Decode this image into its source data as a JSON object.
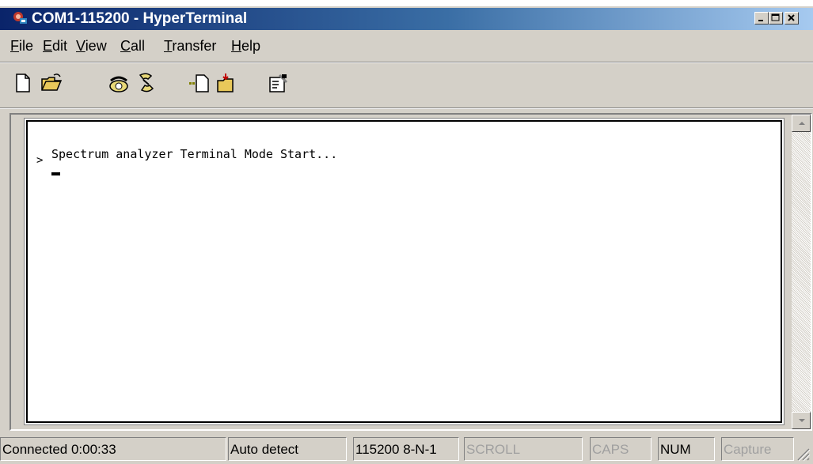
{
  "window": {
    "title": "COM1-115200 - HyperTerminal",
    "icon": "hyperterminal-app-icon",
    "controls": [
      "minimize-icon",
      "maximize-icon",
      "close-icon"
    ]
  },
  "menu": {
    "items": [
      {
        "mnemonic": "F",
        "rest": "ile"
      },
      {
        "mnemonic": "E",
        "rest": "dit"
      },
      {
        "mnemonic": "V",
        "rest": "iew"
      },
      {
        "mnemonic": "C",
        "rest": "all"
      },
      {
        "mnemonic": "T",
        "rest": "ransfer"
      },
      {
        "mnemonic": "H",
        "rest": "elp"
      }
    ]
  },
  "toolbar": {
    "icons": [
      "new-document-icon",
      "open-folder-icon",
      "call-phone-icon",
      "disconnect-phone-icon",
      "send-file-icon",
      "receive-file-icon",
      "properties-icon"
    ]
  },
  "terminal": {
    "line1": "Spectrum analyzer Terminal Mode Start...",
    "prompt": ">",
    "cursor": "_"
  },
  "status": {
    "connected": "Connected 0:00:33",
    "detect": "Auto detect",
    "settings": "115200 8-N-1",
    "scroll": "SCROLL",
    "caps": "CAPS",
    "num": "NUM",
    "capture": "Capture"
  },
  "colors": {
    "title_start": "#0a246a",
    "title_end": "#a6caf0",
    "chrome": "#d4d0c8",
    "terminal_bg": "#ffffff"
  }
}
